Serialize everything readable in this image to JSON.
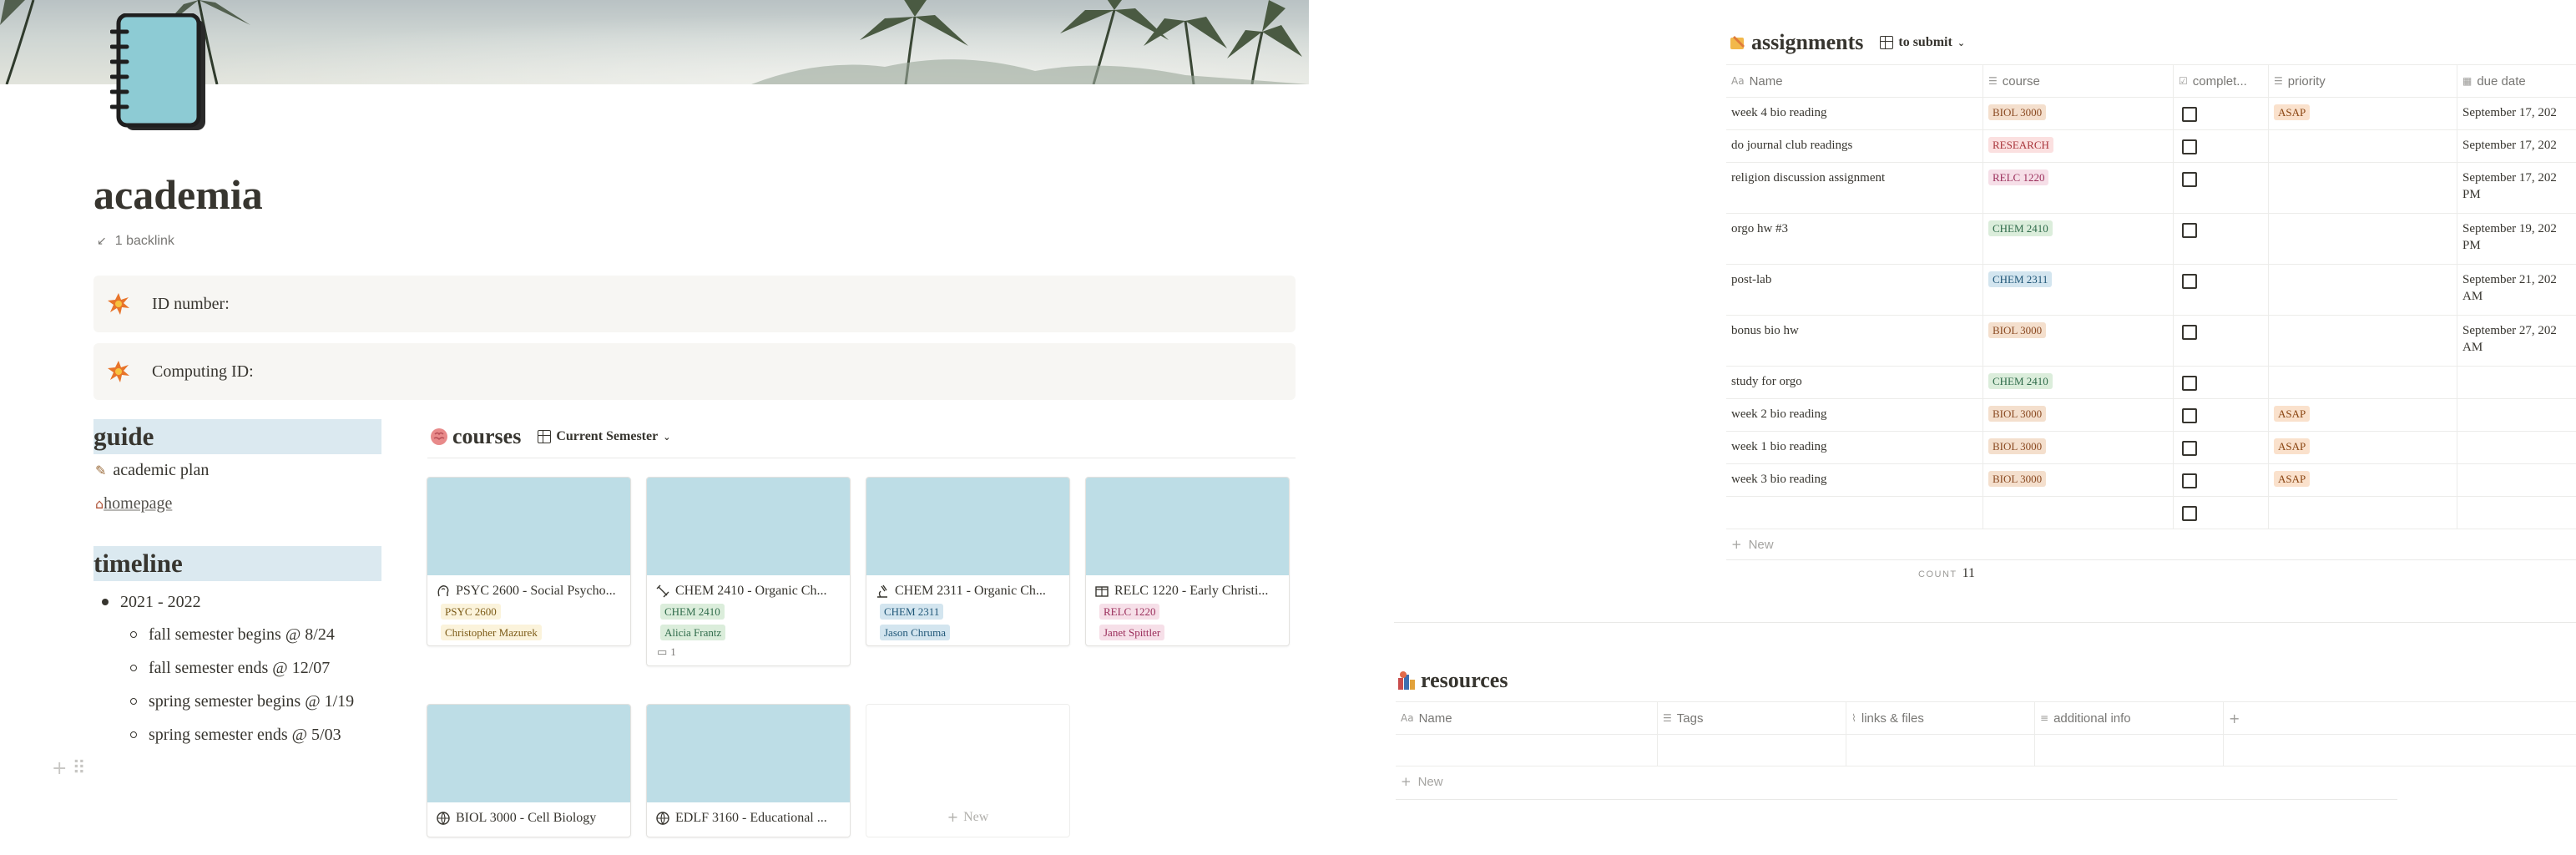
{
  "page": {
    "title": "academia",
    "backlinks": "1 backlink"
  },
  "callouts": [
    {
      "label": "ID number:"
    },
    {
      "label": "Computing ID:"
    }
  ],
  "guide": {
    "heading": "guide",
    "links": [
      {
        "label": "academic plan"
      },
      {
        "label": "homepage"
      }
    ]
  },
  "timeline": {
    "heading": "timeline",
    "year": "2021 - 2022",
    "items": [
      "fall semester begins @ 8/24",
      "fall semester ends @ 12/07",
      "spring semester begins @ 1/19",
      "spring semester ends @ 5/03"
    ]
  },
  "courses": {
    "title": "courses",
    "view": "Current Semester",
    "new_label": "New",
    "cards": [
      {
        "title": "PSYC 2600 - Social Psycho...",
        "code": "PSYC 2600",
        "prof": "Christopher Mazurek",
        "code_color": "yel",
        "prof_color": "yel",
        "icon": "brain-icon"
      },
      {
        "title": "CHEM 2410 - Organic Ch...",
        "code": "CHEM 2410",
        "prof": "Alicia Frantz",
        "code_color": "green",
        "prof_color": "green",
        "icon": "flask-icon",
        "comments": "1"
      },
      {
        "title": "CHEM 2311 - Organic Ch...",
        "code": "CHEM 2311",
        "prof": "Jason Chruma",
        "code_color": "blue",
        "prof_color": "blue",
        "icon": "microscope-icon"
      },
      {
        "title": "RELC 1220 - Early Christi...",
        "code": "RELC 1220",
        "prof": "Janet Spittler",
        "code_color": "pink",
        "prof_color": "pink",
        "icon": "book-icon"
      },
      {
        "title": "BIOL 3000 - Cell Biology",
        "icon": "globe-icon"
      },
      {
        "title": "EDLF 3160 - Educational ...",
        "icon": "globe-icon"
      }
    ]
  },
  "assignments": {
    "title": "assignments",
    "view": "to submit",
    "columns": [
      "Name",
      "course",
      "complet...",
      "priority",
      "due date"
    ],
    "rows": [
      {
        "name": "week 4 bio reading",
        "course": "BIOL 3000",
        "course_color": "brown",
        "priority": "ASAP",
        "due": "September 17, 202"
      },
      {
        "name": "do journal club readings",
        "course": "RESEARCH",
        "course_color": "red",
        "priority": "",
        "due": "September 17, 202"
      },
      {
        "name": "religion discussion assignment",
        "course": "RELC 1220",
        "course_color": "pink",
        "priority": "",
        "due": "September 17, 202",
        "due2": "PM"
      },
      {
        "name": "orgo hw #3",
        "course": "CHEM 2410",
        "course_color": "green",
        "priority": "",
        "due": "September 19, 202",
        "due2": "PM"
      },
      {
        "name": "post-lab",
        "course": "CHEM 2311",
        "course_color": "blue",
        "priority": "",
        "due": "September 21, 202",
        "due2": "AM"
      },
      {
        "name": "bonus bio hw",
        "course": "BIOL 3000",
        "course_color": "brown",
        "priority": "",
        "due": "September 27, 202",
        "due2": "AM"
      },
      {
        "name": "study for orgo",
        "course": "CHEM 2410",
        "course_color": "green",
        "priority": "",
        "due": ""
      },
      {
        "name": "week 2 bio reading",
        "course": "BIOL 3000",
        "course_color": "brown",
        "priority": "ASAP",
        "due": ""
      },
      {
        "name": "week 1 bio reading",
        "course": "BIOL 3000",
        "course_color": "brown",
        "priority": "ASAP",
        "due": ""
      },
      {
        "name": "week 3 bio reading",
        "course": "BIOL 3000",
        "course_color": "brown",
        "priority": "ASAP",
        "due": ""
      },
      {
        "name": "",
        "course": "",
        "course_color": "",
        "priority": "",
        "due": ""
      }
    ],
    "new_label": "New",
    "count_label": "COUNT",
    "count_value": "11"
  },
  "resources": {
    "title": "resources",
    "columns": [
      "Name",
      "Tags",
      "links & files",
      "additional info"
    ],
    "add_column": "+",
    "new_label": "New"
  }
}
